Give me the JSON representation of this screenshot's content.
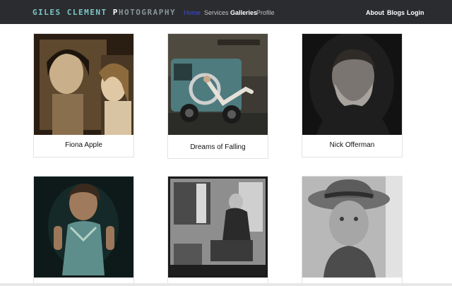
{
  "navbar": {
    "brand_text": "GILES CLEMENT PHOTOGRAPHY",
    "left_links": [
      "Home",
      "Services",
      "Galleries",
      "Profile"
    ],
    "right_links": [
      "About",
      "Blogs",
      "Login"
    ]
  },
  "gallery": {
    "row1": [
      "Fiona Apple",
      "Dreams of Falling",
      "Nick Offerman"
    ]
  },
  "colors": {
    "navbar_bg": "#2b2c2f",
    "active_link": "#3b4bd8",
    "brand_teal": "#7ec6c8"
  }
}
